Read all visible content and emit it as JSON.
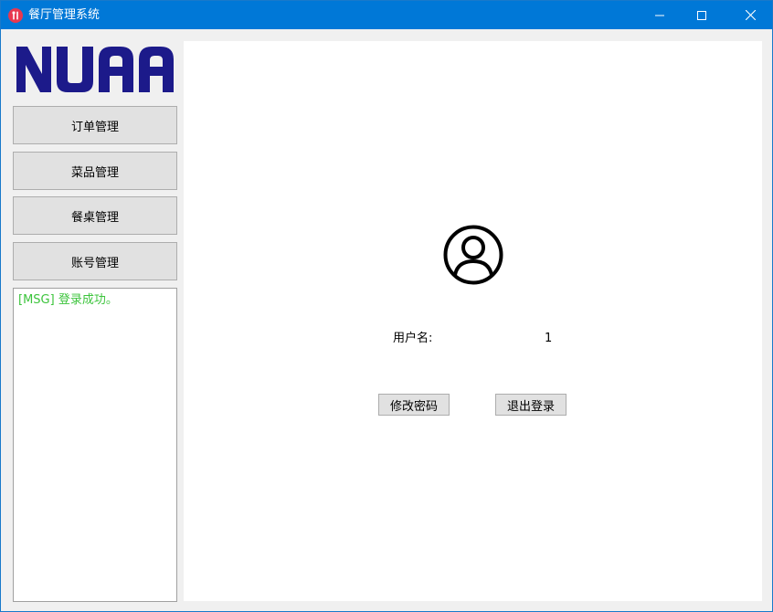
{
  "window": {
    "title": "餐厅管理系统",
    "accent": "#0078d7"
  },
  "logo": {
    "text": "NUAA",
    "color": "#1c1a8a"
  },
  "nav": {
    "items": [
      {
        "label": "订单管理"
      },
      {
        "label": "菜品管理"
      },
      {
        "label": "餐桌管理"
      },
      {
        "label": "账号管理"
      }
    ]
  },
  "log": {
    "lines": [
      "[MSG] 登录成功。"
    ],
    "color": "#3cc43c"
  },
  "account": {
    "username_label": "用户名:",
    "username_value": "1",
    "change_password_label": "修改密码",
    "logout_label": "退出登录"
  }
}
